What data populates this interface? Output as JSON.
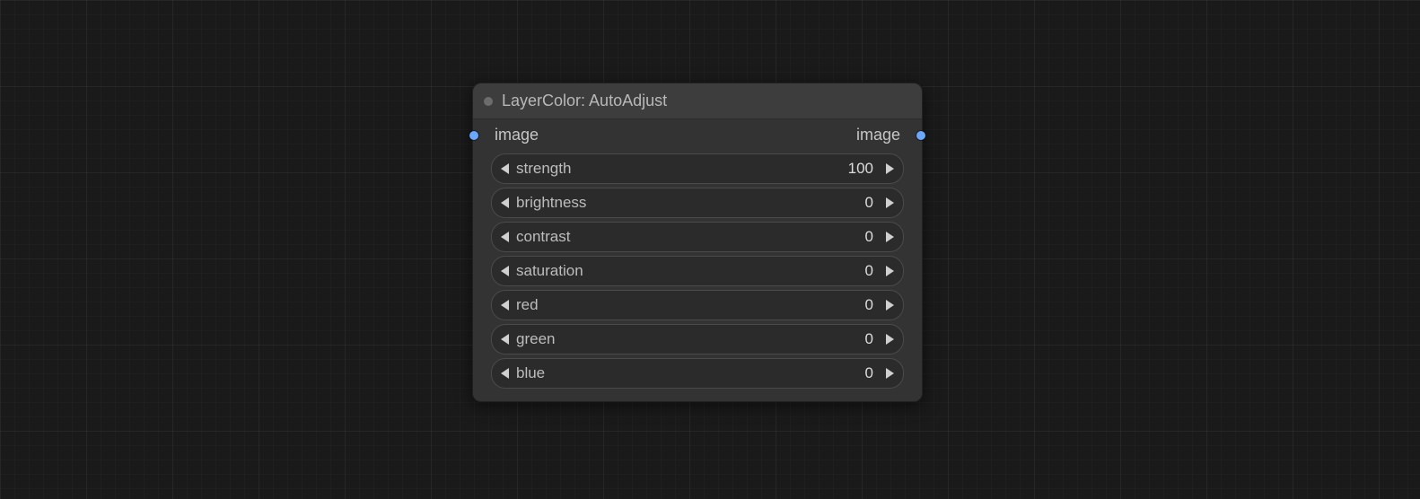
{
  "node": {
    "title": "LayerColor: AutoAdjust",
    "input_port_label": "image",
    "output_port_label": "image",
    "params": [
      {
        "label": "strength",
        "value": "100"
      },
      {
        "label": "brightness",
        "value": "0"
      },
      {
        "label": "contrast",
        "value": "0"
      },
      {
        "label": "saturation",
        "value": "0"
      },
      {
        "label": "red",
        "value": "0"
      },
      {
        "label": "green",
        "value": "0"
      },
      {
        "label": "blue",
        "value": "0"
      }
    ]
  }
}
